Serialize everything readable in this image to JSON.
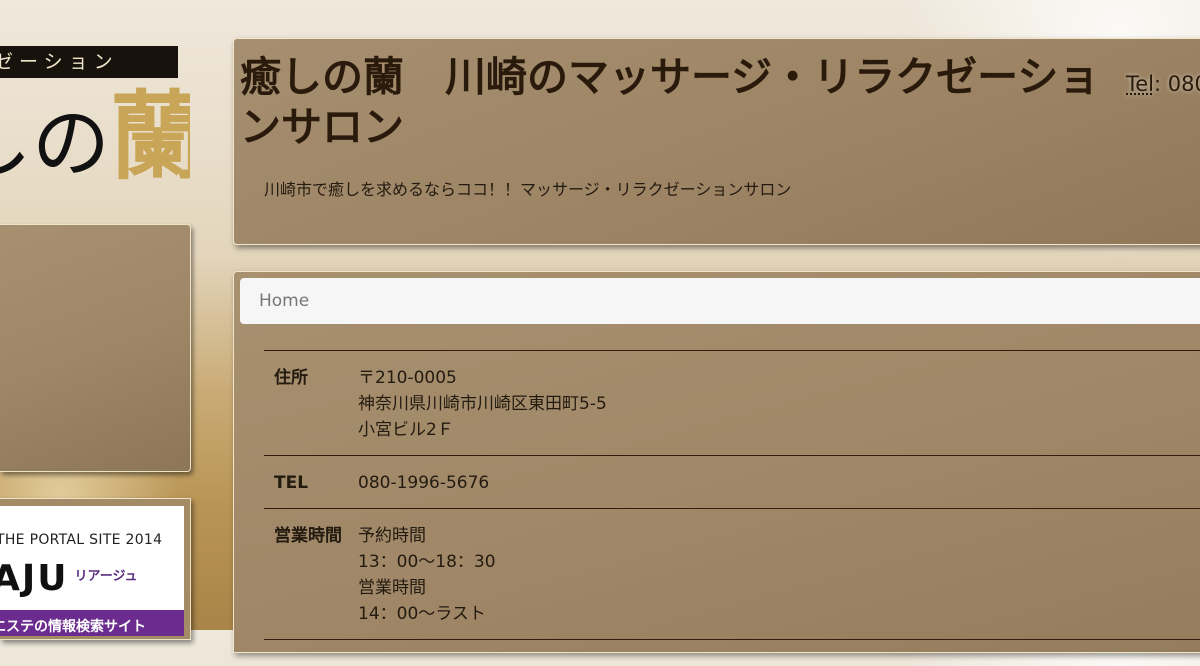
{
  "logo": {
    "tagline": "ゼーション",
    "text_plain": "しの",
    "text_gold": "蘭"
  },
  "header": {
    "title": "癒しの蘭　川崎のマッサージ・リラクゼーションサロン",
    "description": "川崎市で癒しを求めるならココ！！マッサージ・リラクゼーションサロン",
    "tel_label": "Tel",
    "tel_value": ": 080"
  },
  "breadcrumb": {
    "home_label": "Home"
  },
  "info": [
    {
      "label": "住所",
      "lines": [
        "〒210-0005",
        "神奈川県川崎市川崎区東田町5-5",
        "小宮ビル2Ｆ"
      ]
    },
    {
      "label": "TEL",
      "lines": [
        "080-1996-5676"
      ]
    },
    {
      "label": "営業時間",
      "lines": [
        "予約時間",
        "13：00〜18：30",
        "営業時間",
        "14：00〜ラスト"
      ]
    }
  ],
  "banner": {
    "top_text": "THE PORTAL SITE 2014",
    "main_text": "AJU",
    "sub_text": "リアージュ",
    "bar_text": "エステの情報検索サイト"
  }
}
